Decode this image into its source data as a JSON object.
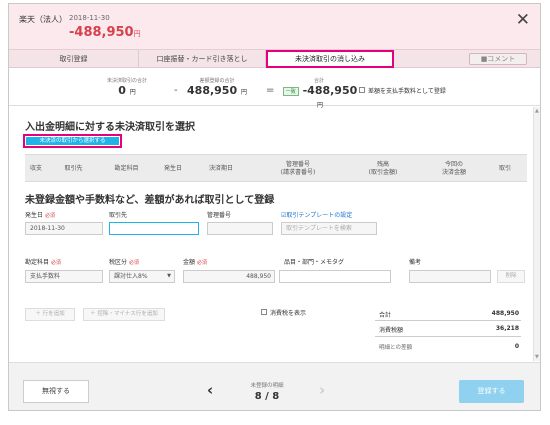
{
  "header": {
    "account": "楽天（法人）",
    "date": "2018-11-30",
    "amount": "-488,950",
    "amount_unit": "円",
    "close_icon": "close-icon"
  },
  "tabs": {
    "t1": "取引登録",
    "t2": "口座振替・カード引き落とし",
    "t3": "未決済取引の消し込み",
    "comment": "■コメント"
  },
  "summary": {
    "l1": "未決済取引の合計",
    "v1": "0",
    "l2": "差額登録の合計",
    "v2": "488,950",
    "l3": "合計",
    "badge": "一致",
    "v3": "-488,950",
    "unit": "円",
    "minus": "-",
    "equals": "=",
    "checkbox_label": "差額を支払手数料として登録"
  },
  "section1": {
    "title": "入出金明細に対する未決済取引を選択",
    "select_button": "未決済の取引から選択する",
    "columns": [
      "収支",
      "取引先",
      "勘定科目",
      "発生日",
      "決済期日",
      "管理番号\n(請求書番号)",
      "残高\n(取引金額)",
      "今回の\n決済金額",
      "取引"
    ]
  },
  "section2": {
    "title": "未登録金額や手数料など、差額があれば取引として登録",
    "date_label": "発生日",
    "required": "必須",
    "date_value": "2018-11-30",
    "partner_label": "取引先",
    "mgmt_label": "管理番号",
    "template_link": "取引テンプレートの設定",
    "template_placeholder": "取引テンプレートを検索",
    "account_label": "勘定科目",
    "tax_label": "税区分",
    "amount_label": "金額",
    "item_label": "品目・部門・メモタグ",
    "note_label": "備考",
    "account_value": "支払手数料",
    "tax_value": "課対仕入8%",
    "amount_value": "488,950",
    "delete": "削除",
    "add_row": "＋ 行を追加",
    "add_deduct": "＋ 控除・マイナス行を追加",
    "show_tax": "消費税を表示",
    "total_label": "合計",
    "total_value": "488,950",
    "tax_amount_label": "消費税額",
    "tax_amount_value": "36,218",
    "diff_label": "明細との差額",
    "diff_value": "0"
  },
  "footer": {
    "ignore": "無視する",
    "nav_label": "未登録の明細",
    "nav_value": "8 / 8",
    "register": "登録する"
  }
}
